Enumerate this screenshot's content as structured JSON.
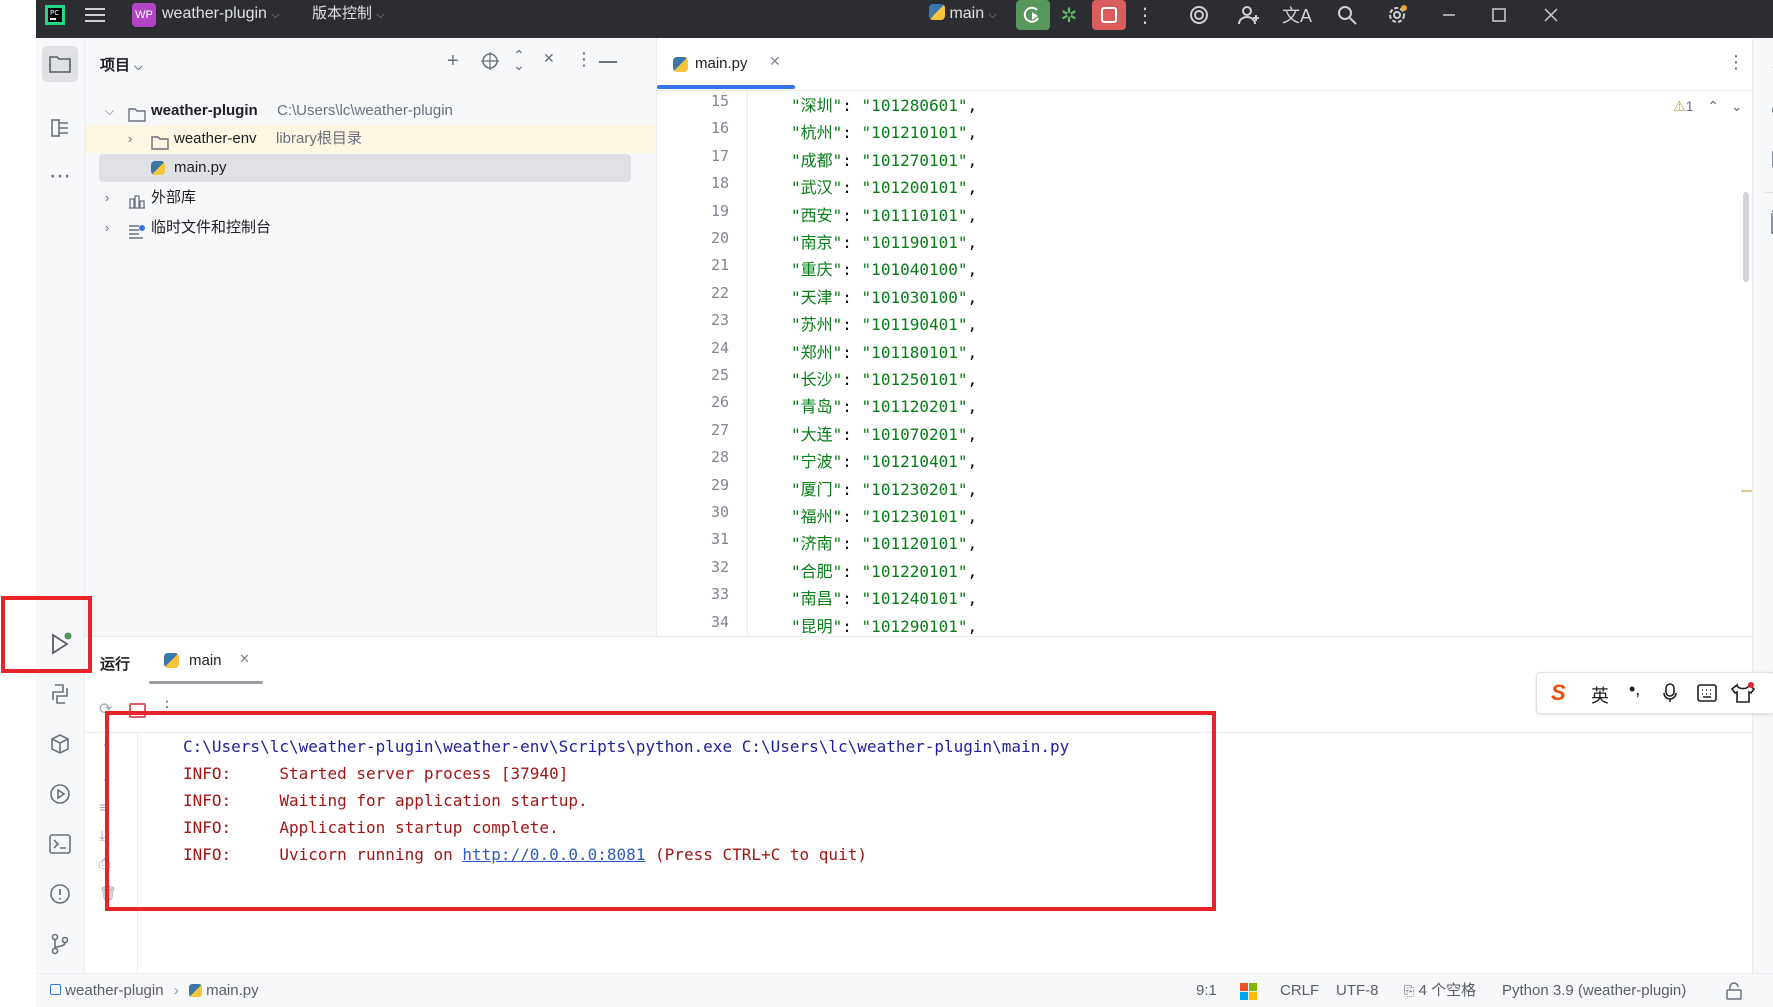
{
  "titlebar": {
    "project_badge": "WP",
    "project_name": "weather-plugin",
    "vcs_menu": "版本控制",
    "branch": "main"
  },
  "project_panel": {
    "title": "项目",
    "root_name": "weather-plugin",
    "root_path": "C:\\Users\\lc\\weather-plugin",
    "env_name": "weather-env",
    "env_hint": "library根目录",
    "main_file": "main.py",
    "external_libs": "外部库",
    "scratches": "临时文件和控制台"
  },
  "editor": {
    "tab_label": "main.py",
    "warning_count": "1",
    "lines": [
      {
        "n": "15",
        "key": "\"深圳\"",
        "val": "\"101280601\""
      },
      {
        "n": "16",
        "key": "\"杭州\"",
        "val": "\"101210101\""
      },
      {
        "n": "17",
        "key": "\"成都\"",
        "val": "\"101270101\""
      },
      {
        "n": "18",
        "key": "\"武汉\"",
        "val": "\"101200101\""
      },
      {
        "n": "19",
        "key": "\"西安\"",
        "val": "\"101110101\""
      },
      {
        "n": "20",
        "key": "\"南京\"",
        "val": "\"101190101\""
      },
      {
        "n": "21",
        "key": "\"重庆\"",
        "val": "\"101040100\""
      },
      {
        "n": "22",
        "key": "\"天津\"",
        "val": "\"101030100\""
      },
      {
        "n": "23",
        "key": "\"苏州\"",
        "val": "\"101190401\""
      },
      {
        "n": "24",
        "key": "\"郑州\"",
        "val": "\"101180101\""
      },
      {
        "n": "25",
        "key": "\"长沙\"",
        "val": "\"101250101\""
      },
      {
        "n": "26",
        "key": "\"青岛\"",
        "val": "\"101120201\""
      },
      {
        "n": "27",
        "key": "\"大连\"",
        "val": "\"101070201\""
      },
      {
        "n": "28",
        "key": "\"宁波\"",
        "val": "\"101210401\""
      },
      {
        "n": "29",
        "key": "\"厦门\"",
        "val": "\"101230201\""
      },
      {
        "n": "30",
        "key": "\"福州\"",
        "val": "\"101230101\""
      },
      {
        "n": "31",
        "key": "\"济南\"",
        "val": "\"101120101\""
      },
      {
        "n": "32",
        "key": "\"合肥\"",
        "val": "\"101220101\""
      },
      {
        "n": "33",
        "key": "\"南昌\"",
        "val": "\"101240101\""
      },
      {
        "n": "34",
        "key": "\"昆明\"",
        "val": "\"101290101\""
      }
    ]
  },
  "run_panel": {
    "tab_run": "运行",
    "tab_main": "main",
    "command": "C:\\Users\\lc\\weather-plugin\\weather-env\\Scripts\\python.exe C:\\Users\\lc\\weather-plugin\\main.py",
    "logs": [
      {
        "level": "INFO:",
        "msg": "Started server process [37940]"
      },
      {
        "level": "INFO:",
        "msg": "Waiting for application startup."
      },
      {
        "level": "INFO:",
        "msg": "Application startup complete."
      }
    ],
    "last_log_level": "INFO:",
    "last_log_prefix": "Uvicorn running on ",
    "last_log_link": "http://0.0.0.0:8081",
    "last_log_suffix": " (Press CTRL+C to quit)"
  },
  "ime": {
    "lang": "英"
  },
  "statusbar": {
    "crumb_project": "weather-plugin",
    "crumb_file": "main.py",
    "position": "9:1",
    "line_sep": "CRLF",
    "encoding": "UTF-8",
    "indent": "4 个空格",
    "interpreter": "Python 3.9 (weather-plugin)"
  },
  "colors": {
    "accent": "#3574f0",
    "highlight_red": "#e8242a",
    "run_green": "#57965c",
    "stop_red": "#db5c5c",
    "string_green": "#067d17",
    "log_red": "#a31515"
  }
}
